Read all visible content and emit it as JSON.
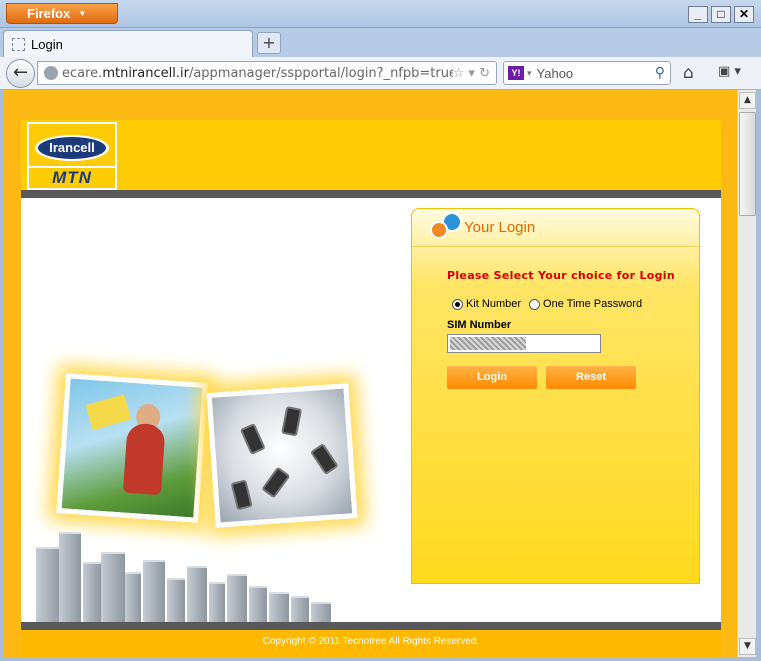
{
  "browser": {
    "menu_button": "Firefox",
    "tab_title": "Login",
    "url_prefix": "ecare.",
    "url_domain": "mtnirancell.ir",
    "url_rest": "/appmanager/sspportal/login?_nfpb=true",
    "search_engine": "Yahoo",
    "search_placeholder": "Yahoo",
    "window_controls": {
      "minimize": "_",
      "maximize": "□",
      "close": "✕"
    }
  },
  "site": {
    "logo_top": "Irancell",
    "logo_bottom": "MTN",
    "footer": "Copyright © 2011 Tecnotree  All Rights Reserved."
  },
  "login": {
    "title": "Your Login",
    "choice_prompt": "Please Select Your choice for Login",
    "options": [
      {
        "label": "Kit Number",
        "selected": true
      },
      {
        "label": "One Time Password",
        "selected": false
      }
    ],
    "sim_label": "SIM Number",
    "login_button": "Login",
    "reset_button": "Reset"
  },
  "colors": {
    "brand_yellow": "#ffcb05",
    "page_bg": "#fdb913",
    "title_orange": "#e06a00",
    "prompt_red": "#d40000",
    "button_orange": "#ff8a00",
    "irancell_blue": "#1b3b7a"
  }
}
